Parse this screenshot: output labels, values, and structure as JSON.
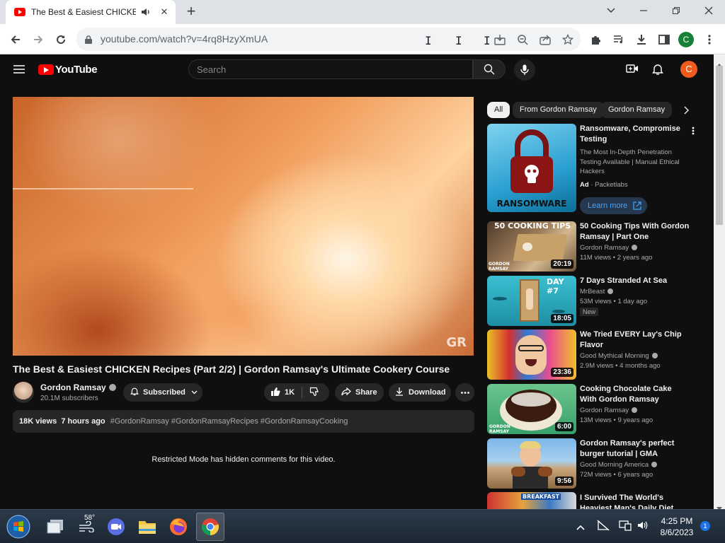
{
  "browser": {
    "tab_title": "The Best & Easiest CHICKEN",
    "url": "youtube.com/watch?v=4rq8HzyXmUA",
    "profile_initial": "C"
  },
  "youtube": {
    "logo_text": "YouTube",
    "search_placeholder": "Search",
    "avatar_initial": "C"
  },
  "video": {
    "watermark": "GR",
    "title": "The Best & Easiest CHICKEN Recipes (Part 2/2) | Gordon Ramsay's Ultimate Cookery Course",
    "channel": "Gordon Ramsay",
    "subscribers": "20.1M subscribers",
    "subscribed_label": "Subscribed",
    "likes": "1K",
    "share_label": "Share",
    "download_label": "Download",
    "views_age": "18K views  7 hours ago",
    "hashtags": "#GordonRamsay #GordonRamsayRecipes #GordonRamsayCooking",
    "comments_notice": "Restricted Mode has hidden comments for this video."
  },
  "chips": [
    "All",
    "From Gordon Ramsay",
    "Gordon Ramsay"
  ],
  "recommendations": [
    {
      "title": "Ransomware, Compromise Testing",
      "description": "The Most In-Depth Penetration Testing Available | Manual Ethical Hackers",
      "ad_label": "Ad",
      "advertiser": "Packetlabs",
      "cta": "Learn more",
      "thumb_text": "RANSOMWARE"
    },
    {
      "title": "50 Cooking Tips With Gordon Ramsay | Part One",
      "channel": "Gordon Ramsay",
      "views": "11M views • 2 years ago",
      "duration": "20:19",
      "thumb_text": "50 COOKING TIPS",
      "thumb_sub": "GORDON RAMSAY"
    },
    {
      "title": "7 Days Stranded At Sea",
      "channel": "MrBeast",
      "views": "53M views • 1 day ago",
      "badge": "New",
      "duration": "18:05",
      "thumb_text": "DAY #7"
    },
    {
      "title": "We Tried EVERY Lay's Chip Flavor",
      "channel": "Good Mythical Morning",
      "views": "2.9M views • 4 months ago",
      "duration": "23:36"
    },
    {
      "title": "Cooking Chocolate Cake With Gordon Ramsay",
      "channel": "Gordon Ramsay",
      "views": "13M views • 9 years ago",
      "duration": "6:00",
      "thumb_sub": "GORDON RAMSAY"
    },
    {
      "title": "Gordon Ramsay's perfect burger tutorial | GMA",
      "channel": "Good Morning America",
      "views": "72M views • 6 years ago",
      "duration": "9:56"
    },
    {
      "title": "I Survived The World's Heaviest Man's Daily Diet",
      "thumb_text": "BREAKFAST"
    }
  ],
  "taskbar": {
    "weather": "58°",
    "time": "4:25 PM",
    "date": "8/6/2023",
    "notifications": "1"
  },
  "colors": {
    "yt_bg": "#0f0f0f",
    "yt_red": "#ff0000",
    "accent_blue": "#3ea6ff",
    "avatar_orange": "#ef5b1f"
  }
}
